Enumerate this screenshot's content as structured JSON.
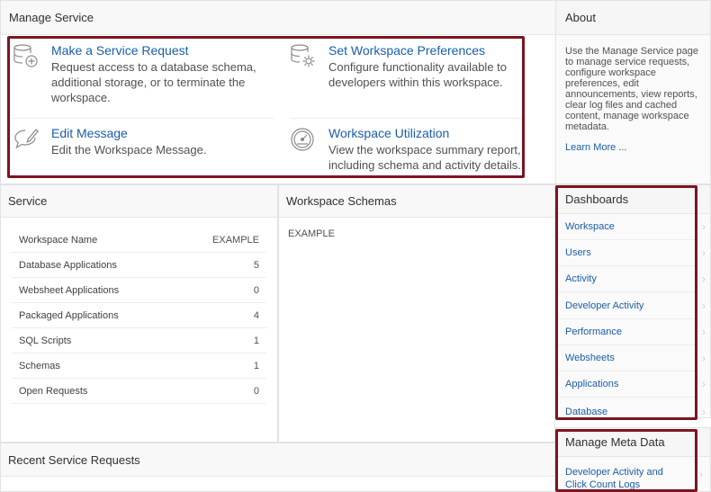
{
  "manage_service": {
    "title": "Manage Service",
    "cards": [
      {
        "title": "Make a Service Request",
        "desc": "Request access to a database schema, additional storage, or to terminate the workspace.",
        "icon": "database-add-icon"
      },
      {
        "title": "Set Workspace Preferences",
        "desc": "Configure functionality available to developers within this workspace.",
        "icon": "database-gear-icon"
      },
      {
        "title": "Edit Message",
        "desc": "Edit the Workspace Message.",
        "icon": "speech-bubble-pen-icon"
      },
      {
        "title": "Workspace Utilization",
        "desc": "View the workspace summary report, including schema and activity details.",
        "icon": "gauge-icon"
      }
    ]
  },
  "about": {
    "title": "About",
    "text": "Use the Manage Service page to manage service requests, configure workspace preferences, edit announcements, view reports, clear log files and cached content, manage workspace metadata.",
    "learn_more": "Learn More ..."
  },
  "service": {
    "title": "Service",
    "rows": [
      {
        "label": "Workspace Name",
        "value": "EXAMPLE"
      },
      {
        "label": "Database Applications",
        "value": "5"
      },
      {
        "label": "Websheet Applications",
        "value": "0"
      },
      {
        "label": "Packaged Applications",
        "value": "4"
      },
      {
        "label": "SQL Scripts",
        "value": "1"
      },
      {
        "label": "Schemas",
        "value": "1"
      },
      {
        "label": "Open Requests",
        "value": "0"
      }
    ]
  },
  "schemas": {
    "title": "Workspace Schemas",
    "items": [
      "EXAMPLE"
    ]
  },
  "dashboards": {
    "title": "Dashboards",
    "links": [
      "Workspace",
      "Users",
      "Activity",
      "Developer Activity",
      "Performance",
      "Websheets",
      "Applications",
      "Database"
    ]
  },
  "recent": {
    "title": "Recent Service Requests"
  },
  "meta": {
    "title": "Manage Meta Data",
    "link": "Developer Activity and Click Count Logs"
  },
  "colors": {
    "link": "#1a5da8",
    "highlight": "#7b1521"
  }
}
